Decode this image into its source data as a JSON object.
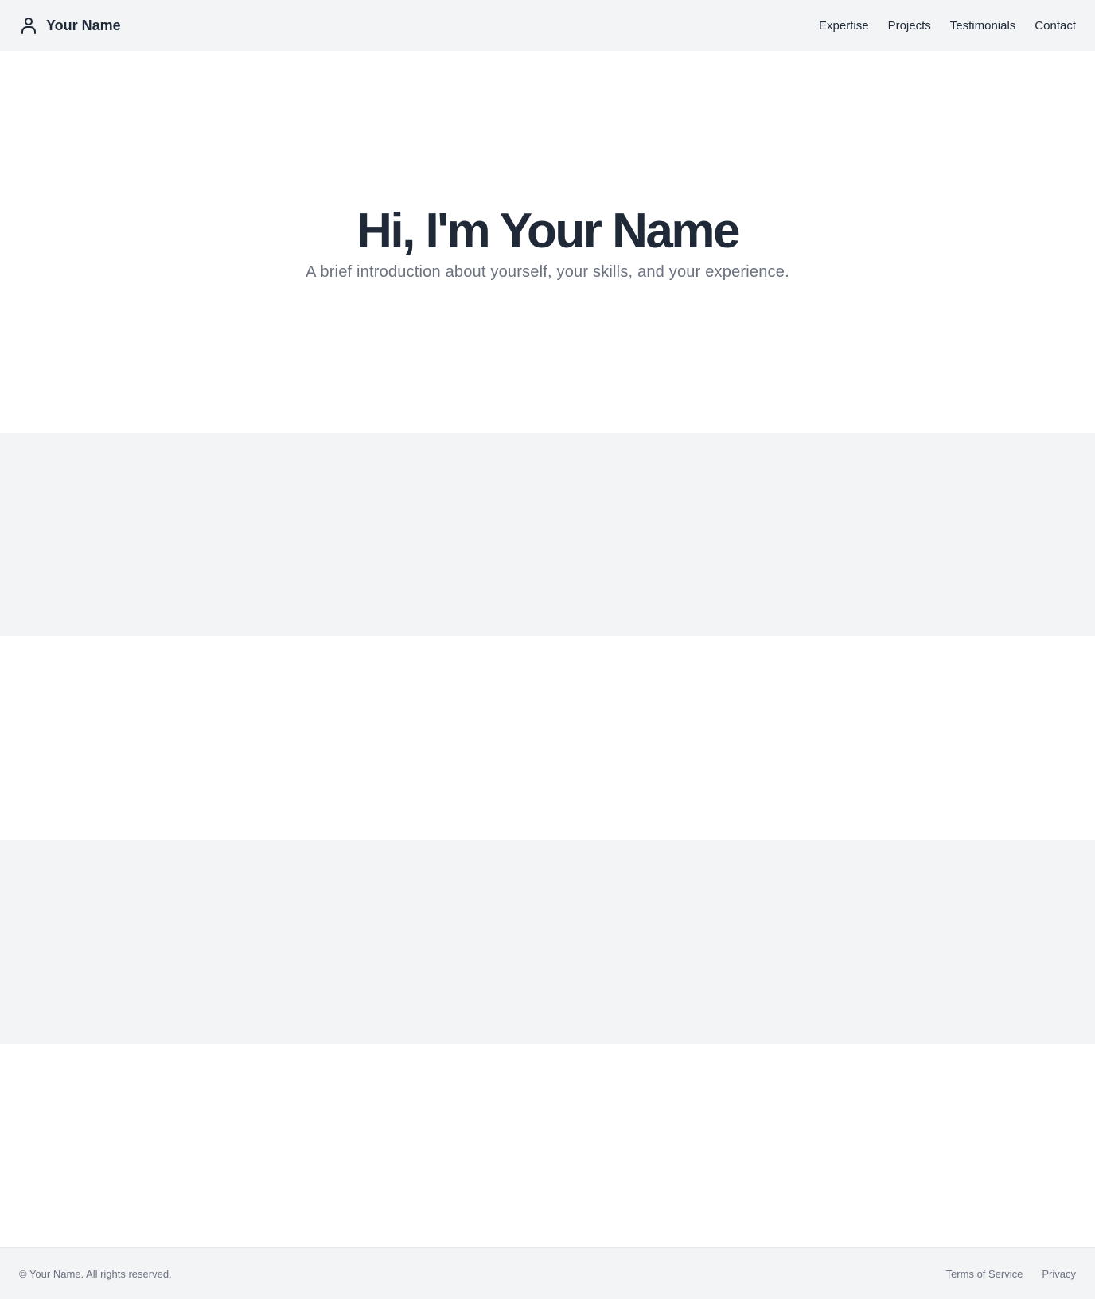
{
  "header": {
    "brand_name": "Your Name",
    "brand_icon": "user-icon",
    "nav": [
      {
        "label": "Expertise"
      },
      {
        "label": "Projects"
      },
      {
        "label": "Testimonials"
      },
      {
        "label": "Contact"
      }
    ]
  },
  "hero": {
    "title": "Hi, I'm Your Name",
    "subtitle": "A brief introduction about yourself, your skills, and your experience."
  },
  "footer": {
    "copyright": "© Your Name. All rights reserved.",
    "links": [
      {
        "label": "Terms of Service"
      },
      {
        "label": "Privacy"
      }
    ]
  },
  "colors": {
    "text_primary": "#1f2937",
    "text_muted": "#6b7280",
    "band_gray": "#f3f4f6",
    "band_white": "#ffffff"
  }
}
